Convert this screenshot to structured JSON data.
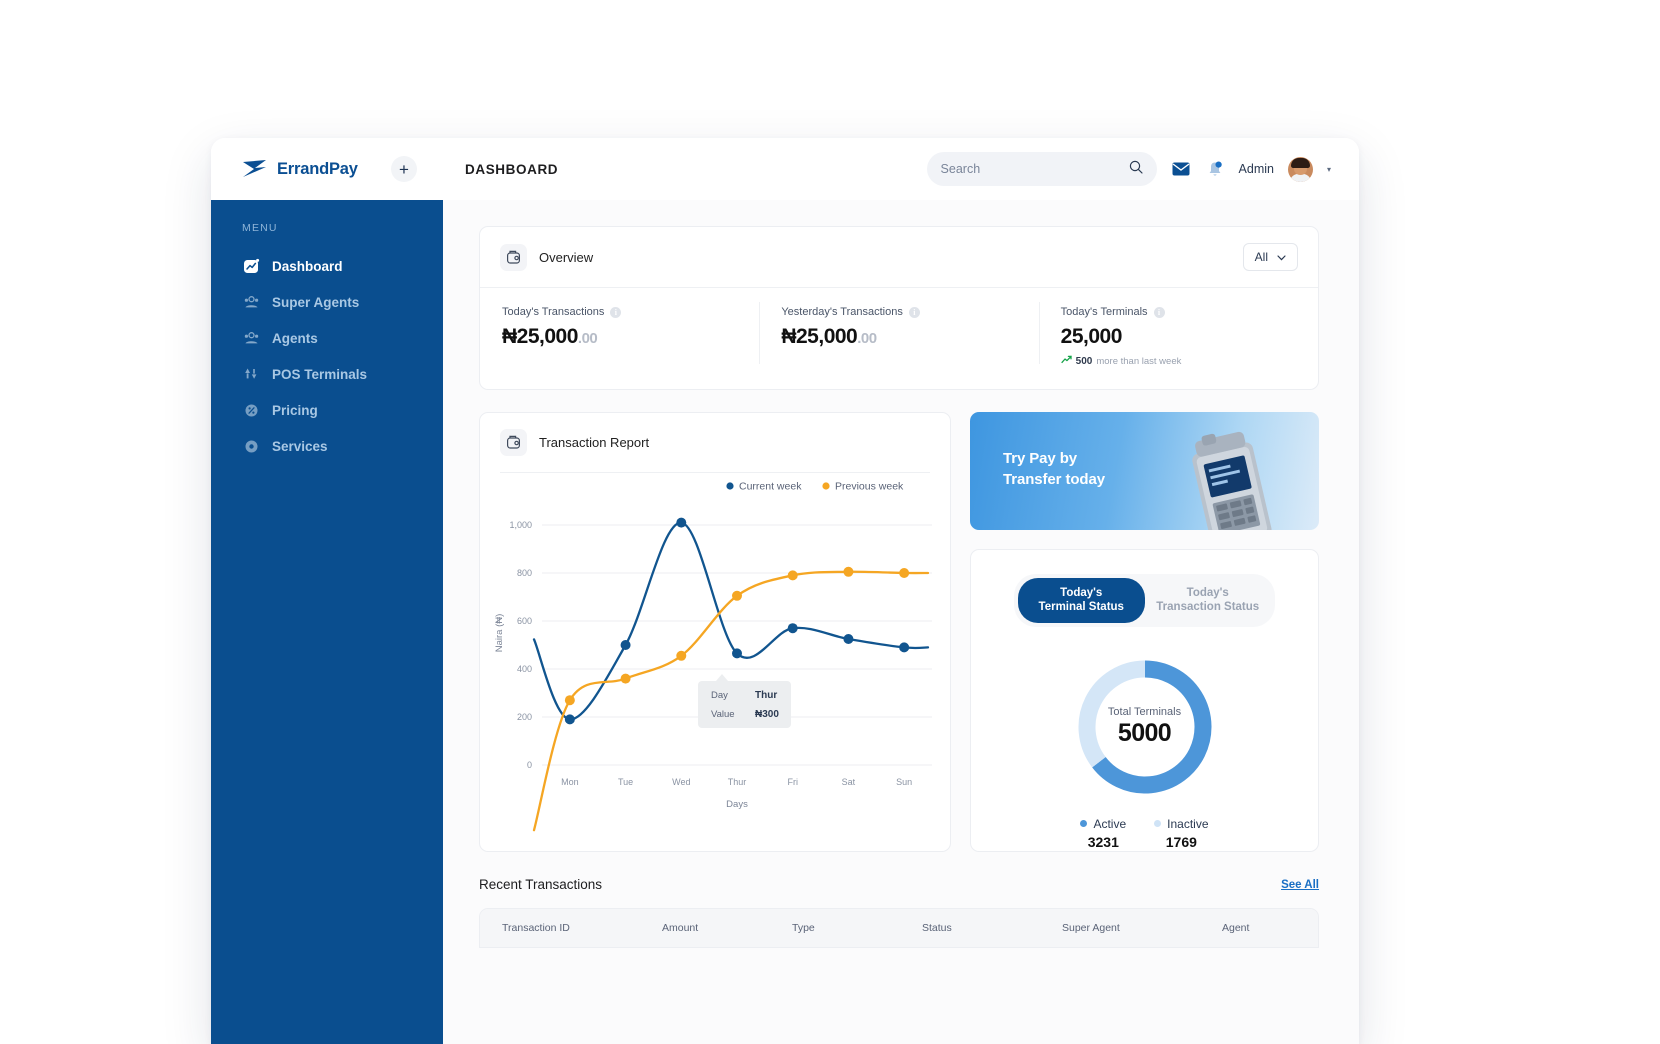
{
  "brand": {
    "name": "ErrandPay",
    "add_label": "+"
  },
  "header": {
    "page_title": "DASHBOARD",
    "search": {
      "placeholder": "Search",
      "value": "",
      "icon": "search-icon"
    },
    "mail_icon": "mail-icon",
    "notification_icon": "bell-icon",
    "user_name": "Admin",
    "caret": "▾"
  },
  "sidebar": {
    "section_label": "MENU",
    "items": [
      {
        "label": "Dashboard",
        "icon": "dashboard-icon",
        "active": true
      },
      {
        "label": "Super Agents",
        "icon": "super-agents-icon",
        "active": false
      },
      {
        "label": "Agents",
        "icon": "agents-icon",
        "active": false
      },
      {
        "label": "POS Terminals",
        "icon": "pos-terminal-icon",
        "active": false
      },
      {
        "label": "Pricing",
        "icon": "pricing-icon",
        "active": false
      },
      {
        "label": "Services",
        "icon": "services-icon",
        "active": false
      }
    ],
    "bg_color": "#0a4e8f"
  },
  "overview": {
    "title": "Overview",
    "icon": "wallet-icon",
    "filter": {
      "value": "All",
      "caret": "⌄"
    },
    "stats": [
      {
        "label": "Today's Transactions",
        "currency": "₦",
        "amount": "25,000",
        "cents": ".00",
        "info": "i"
      },
      {
        "label": "Yesterday's Transactions",
        "currency": "₦",
        "amount": "25,000",
        "cents": ".00",
        "info": "i"
      },
      {
        "label": "Today's Terminals",
        "currency": "",
        "amount": "25,000",
        "cents": "",
        "info": "i",
        "delta_value": "500",
        "delta_text": "more than last week",
        "delta_icon": "trend-up-icon"
      }
    ]
  },
  "transaction_report": {
    "title": "Transaction Report",
    "icon": "wallet-icon"
  },
  "chart_data": {
    "type": "line",
    "title": "Transaction Report",
    "xlabel": "Days",
    "ylabel": "Naira (₦)",
    "categories": [
      "Mon",
      "Tue",
      "Wed",
      "Thur",
      "Fri",
      "Sat",
      "Sun"
    ],
    "ylim": [
      0,
      1100
    ],
    "yticks": [
      0,
      200,
      400,
      600,
      800,
      1000
    ],
    "ytick_labels": [
      "0",
      "200",
      "400",
      "600",
      "800",
      "1,000"
    ],
    "grid": true,
    "legend_position": "top-right",
    "series": [
      {
        "name": "Current week",
        "color": "#11558f",
        "values": [
          190,
          500,
          1010,
          465,
          570,
          525,
          490
        ]
      },
      {
        "name": "Previous week",
        "color": "#f5a623",
        "values": [
          270,
          360,
          455,
          705,
          790,
          805,
          800
        ]
      }
    ],
    "tooltip": {
      "day_label": "Day",
      "day_value": "Thur",
      "value_label": "Value",
      "value_value": "₦300"
    }
  },
  "promo": {
    "line1": "Try Pay by",
    "line2": "Transfer today",
    "image": "pos-device-image"
  },
  "terminal_status": {
    "tabs": [
      {
        "line1": "Today's",
        "line2": "Terminal Status",
        "active": true
      },
      {
        "line1": "Today's",
        "line2": "Transaction Status",
        "active": false
      }
    ],
    "donut": {
      "center_label": "Total Terminals",
      "center_value": "5000",
      "active_color": "#4d96d9",
      "inactive_color": "#d4e6f7"
    },
    "legend": [
      {
        "label": "Active",
        "value": "3231",
        "color": "#4d96d9"
      },
      {
        "label": "Inactive",
        "value": "1769",
        "color": "#cfe3f6"
      }
    ]
  },
  "recent_transactions": {
    "title": "Recent Transactions",
    "see_all": "See All",
    "columns": [
      "Transaction ID",
      "Amount",
      "Type",
      "Status",
      "Super Agent",
      "Agent"
    ]
  }
}
